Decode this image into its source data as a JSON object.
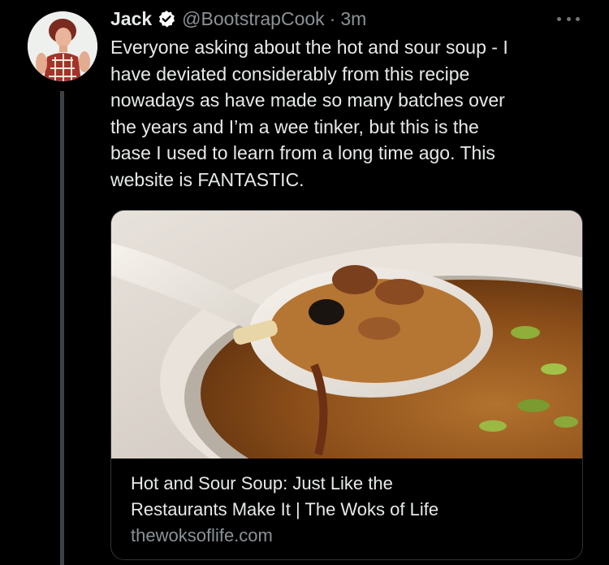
{
  "tweet": {
    "author_name": "Jack",
    "handle": "@BootstrapCook",
    "separator": "·",
    "time": "3m",
    "verified_icon": "verified-badge-icon",
    "more_icon": "more-options-icon",
    "text_lines": [
      "Everyone asking about the hot and sour soup - I",
      "have deviated considerably from this recipe",
      "nowadays as have made so many batches over",
      "the years and I’m a wee tinker, but this is the",
      "base I used to learn from a long time ago. This",
      "website is FANTASTIC."
    ]
  },
  "link_card": {
    "title_lines": [
      "Hot and Sour Soup: Just Like the",
      "Restaurants Make It | The Woks of Life"
    ],
    "domain": "thewoksoflife.com"
  },
  "colors": {
    "background": "#000000",
    "text_primary": "#e7e9ea",
    "text_secondary": "#8b9297",
    "border": "#2f3336"
  }
}
